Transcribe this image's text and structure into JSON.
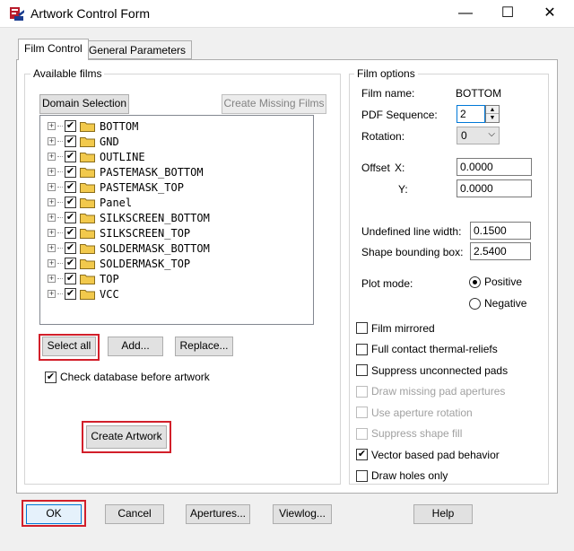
{
  "window": {
    "title": "Artwork Control Form",
    "minimize": "—",
    "maximize": "☐",
    "close": "✕"
  },
  "tabs": [
    {
      "label": "Film Control",
      "active": true
    },
    {
      "label": "General Parameters",
      "active": false
    }
  ],
  "available_films": {
    "title": "Available films",
    "domain_selection": "Domain Selection",
    "create_missing": "Create Missing Films",
    "films": [
      {
        "name": "BOTTOM",
        "checked": true
      },
      {
        "name": "GND",
        "checked": true
      },
      {
        "name": "OUTLINE",
        "checked": true
      },
      {
        "name": "PASTEMASK_BOTTOM",
        "checked": true
      },
      {
        "name": "PASTEMASK_TOP",
        "checked": true
      },
      {
        "name": "Panel",
        "checked": true
      },
      {
        "name": "SILKSCREEN_BOTTOM",
        "checked": true
      },
      {
        "name": "SILKSCREEN_TOP",
        "checked": true
      },
      {
        "name": "SOLDERMASK_BOTTOM",
        "checked": true
      },
      {
        "name": "SOLDERMASK_TOP",
        "checked": true
      },
      {
        "name": "TOP",
        "checked": true
      },
      {
        "name": "VCC",
        "checked": true
      }
    ],
    "select_all": "Select all",
    "add": "Add...",
    "replace": "Replace...",
    "check_db": "Check database before artwork",
    "check_db_checked": true,
    "create_artwork": "Create Artwork"
  },
  "film_options": {
    "title": "Film options",
    "film_name_label": "Film name:",
    "film_name_value": "BOTTOM",
    "pdf_seq_label": "PDF Sequence:",
    "pdf_seq_value": "2",
    "rotation_label": "Rotation:",
    "rotation_value": "0",
    "offset_label": "Offset",
    "x_label": "X:",
    "x_value": "0.0000",
    "y_label": "Y:",
    "y_value": "0.0000",
    "undef_width_label": "Undefined line width:",
    "undef_width_value": "0.1500",
    "shape_box_label": "Shape bounding box:",
    "shape_box_value": "2.5400",
    "plot_mode_label": "Plot mode:",
    "positive": "Positive",
    "negative": "Negative",
    "plot_mode": "Positive",
    "checkboxes": [
      {
        "label": "Film mirrored",
        "checked": false,
        "enabled": true
      },
      {
        "label": "Full contact thermal-reliefs",
        "checked": false,
        "enabled": true
      },
      {
        "label": "Suppress unconnected pads",
        "checked": false,
        "enabled": true
      },
      {
        "label": "Draw missing pad apertures",
        "checked": false,
        "enabled": false
      },
      {
        "label": "Use aperture rotation",
        "checked": false,
        "enabled": false
      },
      {
        "label": "Suppress shape fill",
        "checked": false,
        "enabled": false
      },
      {
        "label": "Vector based pad behavior",
        "checked": true,
        "enabled": true
      },
      {
        "label": "Draw holes only",
        "checked": false,
        "enabled": true
      }
    ]
  },
  "footer": {
    "ok": "OK",
    "cancel": "Cancel",
    "apertures": "Apertures...",
    "viewlog": "Viewlog...",
    "help": "Help"
  },
  "colors": {
    "highlight_box": "#d21f2a",
    "folder": "#f2c94c"
  }
}
